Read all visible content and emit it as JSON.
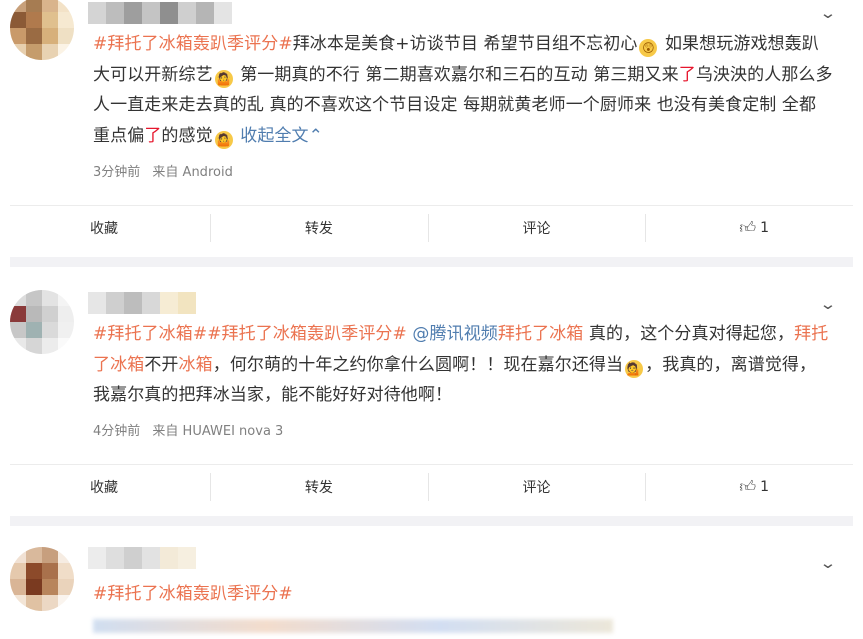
{
  "posts": [
    {
      "text_parts": [
        {
          "t": "topic",
          "v": "#拜托了冰箱轰趴季评分#"
        },
        {
          "t": "plain",
          "v": "拜冰本是美食+访谈节目 希望节目组不忘初心"
        },
        {
          "t": "emoji",
          "v": "😲"
        },
        {
          "t": "plain",
          "v": " 如果想玩游戏想轰趴大可以开新综艺"
        },
        {
          "t": "emoji",
          "v": "🤷"
        },
        {
          "t": "plain",
          "v": " 第一期真的不行 第二期喜欢嘉尔和三石的互动 第三期又来"
        },
        {
          "t": "hl",
          "v": "了"
        },
        {
          "t": "plain",
          "v": "乌泱泱的人那么多人一直走来走去真的乱 真的不喜欢这个节目设定 每期就黄老师一个厨师来 也没有美食定制 全都重点偏"
        },
        {
          "t": "hl",
          "v": "了"
        },
        {
          "t": "plain",
          "v": "的感觉"
        },
        {
          "t": "emoji",
          "v": "🤷"
        },
        {
          "t": "link",
          "v": " 收起全文"
        },
        {
          "t": "link",
          "v": "⌃"
        }
      ],
      "time": "3分钟前",
      "source": "来自 Android",
      "actions": {
        "fav": "收藏",
        "repost": "转发",
        "comment": "评论",
        "like": "1"
      }
    },
    {
      "text_parts": [
        {
          "t": "topic",
          "v": "#拜托了冰箱##拜托了冰箱轰趴季评分#"
        },
        {
          "t": "link",
          "v": " @腾讯视频"
        },
        {
          "t": "topic",
          "v": "拜托了冰箱"
        },
        {
          "t": "plain",
          "v": " 真的，这个分真对得起您，"
        },
        {
          "t": "topic",
          "v": "拜托了冰箱"
        },
        {
          "t": "plain",
          "v": "不开"
        },
        {
          "t": "topic",
          "v": "冰箱"
        },
        {
          "t": "plain",
          "v": "，何尔萌的十年之约你拿什么圆啊！！现在嘉尔还得当"
        },
        {
          "t": "emoji",
          "v": "💁"
        },
        {
          "t": "plain",
          "v": "，我真的，离谱觉得，我嘉尔真的把拜冰当家，能不能好好对待他啊！"
        }
      ],
      "time": "4分钟前",
      "source": "来自 HUAWEI nova 3",
      "actions": {
        "fav": "收藏",
        "repost": "转发",
        "comment": "评论",
        "like": "1"
      }
    },
    {
      "text_parts": [
        {
          "t": "topic",
          "v": "#拜托了冰箱轰趴季评分#"
        }
      ]
    }
  ],
  "icons": {
    "chevron": "chevron-down-icon",
    "like": "thumbs-up-icon"
  },
  "colors": {
    "topic": "#eb7350",
    "link": "#507daf",
    "highlight": "#e6162d",
    "meta": "#808080"
  }
}
